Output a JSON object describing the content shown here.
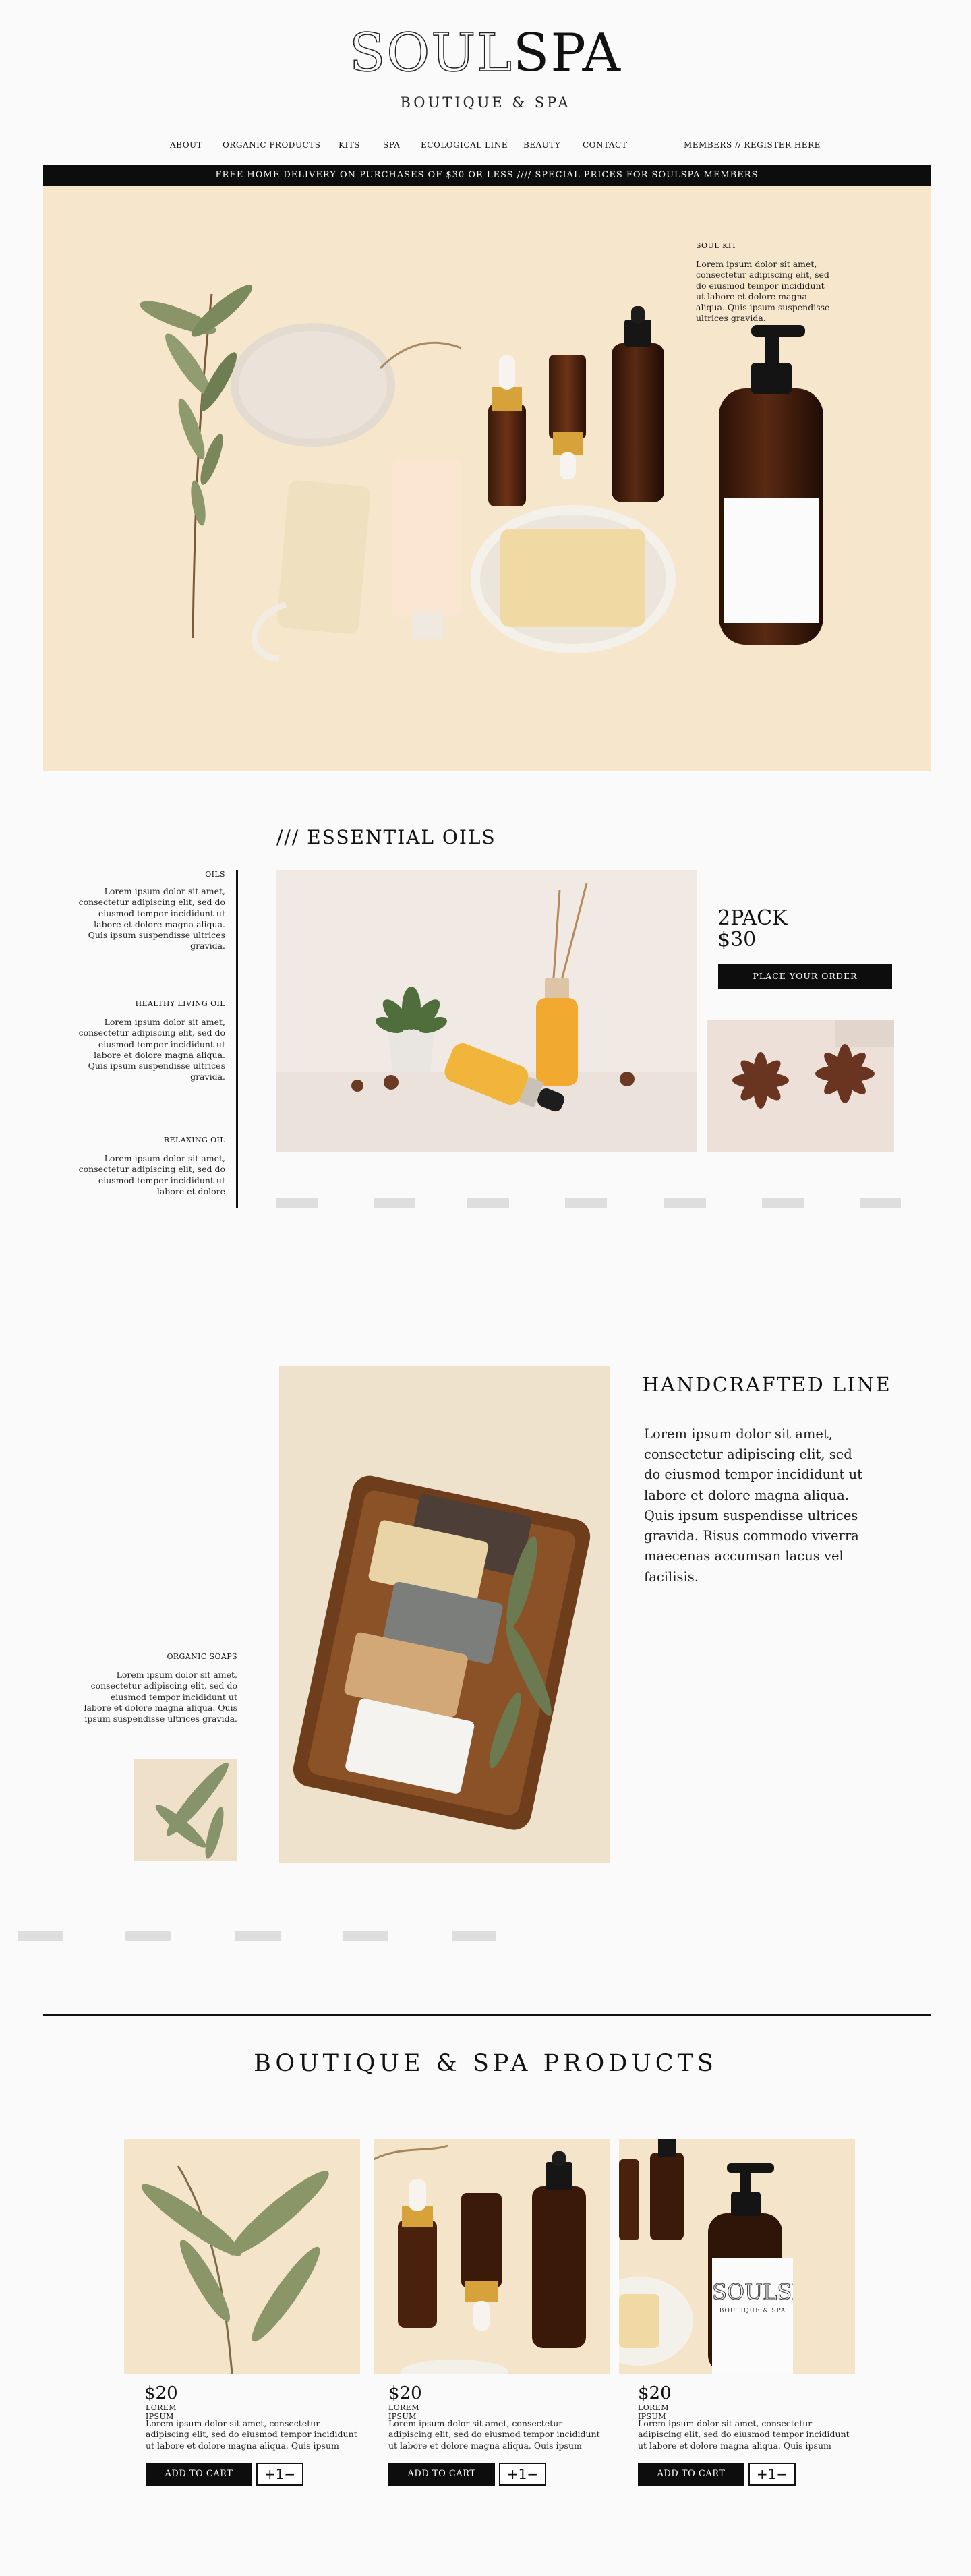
{
  "header": {
    "logo_soul": "SOUL",
    "logo_spa": "SPA",
    "subtitle": "BOUTIQUE & SPA"
  },
  "nav": {
    "items": [
      "ABOUT",
      "ORGANIC PRODUCTS",
      "KITS",
      "SPA",
      "ECOLOGICAL LINE",
      "BEAUTY",
      "CONTACT"
    ],
    "account": "MEMBERS  // REGISTER HERE"
  },
  "banner": "FREE HOME DELIVERY ON PURCHASES OF $30 OR LESS //// SPECIAL PRICES FOR SOULSPA MEMBERS",
  "hero": {
    "kit_title": "SOUL KIT",
    "kit_text": "Lorem ipsum dolor sit amet, consectetur adipiscing elit, sed do eiusmod tempor incididunt ut labore et dolore magna aliqua. Quis ipsum suspendisse ultrices gravida."
  },
  "oils": {
    "title": "/// ESSENTIAL OILS",
    "side": [
      {
        "title": "OILS",
        "text": "Lorem ipsum dolor sit amet, consectetur adipiscing elit, sed do eiusmod tempor incididunt ut labore et dolore magna aliqua. Quis ipsum suspendisse ultrices gravida."
      },
      {
        "title": "HEALTHY LIVING OIL",
        "text": "Lorem ipsum dolor sit amet, consectetur adipiscing elit, sed do eiusmod tempor incididunt ut labore et dolore magna aliqua. Quis ipsum suspendisse ultrices gravida."
      },
      {
        "title": "RELAXING OIL",
        "text": "Lorem ipsum dolor sit amet, consectetur adipiscing elit, sed do eiusmod tempor incididunt ut labore et dolore"
      }
    ],
    "pack": "2PACK",
    "price": "$30",
    "order_button": "PLACE YOUR ORDER"
  },
  "handcrafted": {
    "title": "HANDCRAFTED LINE",
    "text": "Lorem ipsum dolor sit amet, consectetur adipiscing elit, sed do eiusmod tempor incididunt ut labore et dolore magna aliqua. Quis ipsum suspendisse ultrices gravida. Risus commodo viverra maecenas accumsan lacus vel facilisis.",
    "side_title": "ORGANIC SOAPS",
    "side_text": "Lorem ipsum dolor sit amet, consectetur adipiscing elit, sed do eiusmod tempor incididunt ut labore et dolore magna aliqua. Quis ipsum suspendisse ultrices gravida."
  },
  "products": {
    "title": "BOUTIQUE & SPA PRODUCTS",
    "items": [
      {
        "price": "$20",
        "name": "LOREM IPSUM",
        "desc": "Lorem ipsum dolor sit amet, consectetur adipiscing elit, sed do eiusmod tempor incididunt ut labore et dolore magna aliqua. Quis ipsum",
        "cart": "ADD TO CART",
        "qty": "+1−"
      },
      {
        "price": "$20",
        "name": "LOREM IPSUM",
        "desc": "Lorem ipsum dolor sit amet, consectetur adipiscing elit, sed do eiusmod tempor incididunt ut labore et dolore magna aliqua. Quis ipsum",
        "cart": "ADD TO CART",
        "qty": "+1−"
      },
      {
        "price": "$20",
        "name": "LOREM IPSUM",
        "desc": "Lorem ipsum dolor sit amet, consectetur adipiscing elit, sed do eiusmod tempor incididunt ut labore et dolore magna aliqua. Quis ipsum",
        "cart": "ADD TO CART",
        "qty": "+1−"
      }
    ],
    "label_logo": "SOULSPA",
    "label_sub": "BOUTIQUE & SPA"
  },
  "colors": {
    "background": "#fafafa",
    "ink": "#0d0d0d",
    "cream": "#f6e6cc",
    "placeholder": "#dedede"
  }
}
